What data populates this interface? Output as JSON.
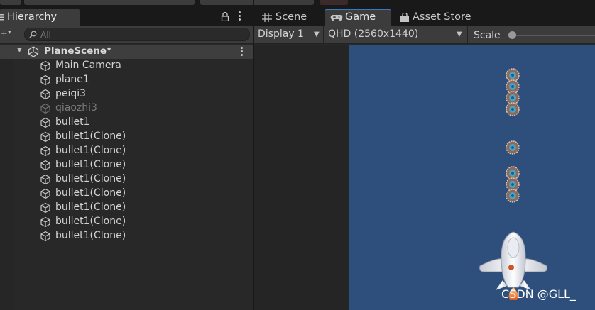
{
  "hierarchy": {
    "tab_label": "Hierarchy",
    "search_placeholder": "All",
    "add_button": "+",
    "scene": {
      "name": "PlaneScene*"
    },
    "objects": [
      {
        "label": "Main Camera",
        "active": true
      },
      {
        "label": "plane1",
        "active": true
      },
      {
        "label": "peiqi3",
        "active": true
      },
      {
        "label": "qiaozhi3",
        "active": false
      },
      {
        "label": "bullet1",
        "active": true
      },
      {
        "label": "bullet1(Clone)",
        "active": true
      },
      {
        "label": "bullet1(Clone)",
        "active": true
      },
      {
        "label": "bullet1(Clone)",
        "active": true
      },
      {
        "label": "bullet1(Clone)",
        "active": true
      },
      {
        "label": "bullet1(Clone)",
        "active": true
      },
      {
        "label": "bullet1(Clone)",
        "active": true
      },
      {
        "label": "bullet1(Clone)",
        "active": true
      },
      {
        "label": "bullet1(Clone)",
        "active": true
      }
    ]
  },
  "game_panel": {
    "tabs": [
      {
        "label": "Scene",
        "icon": "grid-icon",
        "active": false
      },
      {
        "label": "Game",
        "icon": "gamepad-icon",
        "active": true
      },
      {
        "label": "Asset Store",
        "icon": "shopping-bag-icon",
        "active": false
      }
    ],
    "display_select": "Display 1",
    "resolution_select": "QHD (2560x1440)",
    "scale_label": "Scale",
    "scale_value": 0
  },
  "viewport": {
    "background_color": "#2e4f7c",
    "watermark": "CSDN @GLL_"
  },
  "colors": {
    "accent": "#3a79bb",
    "panel": "#282828",
    "toolbar": "#3c3c3c"
  }
}
